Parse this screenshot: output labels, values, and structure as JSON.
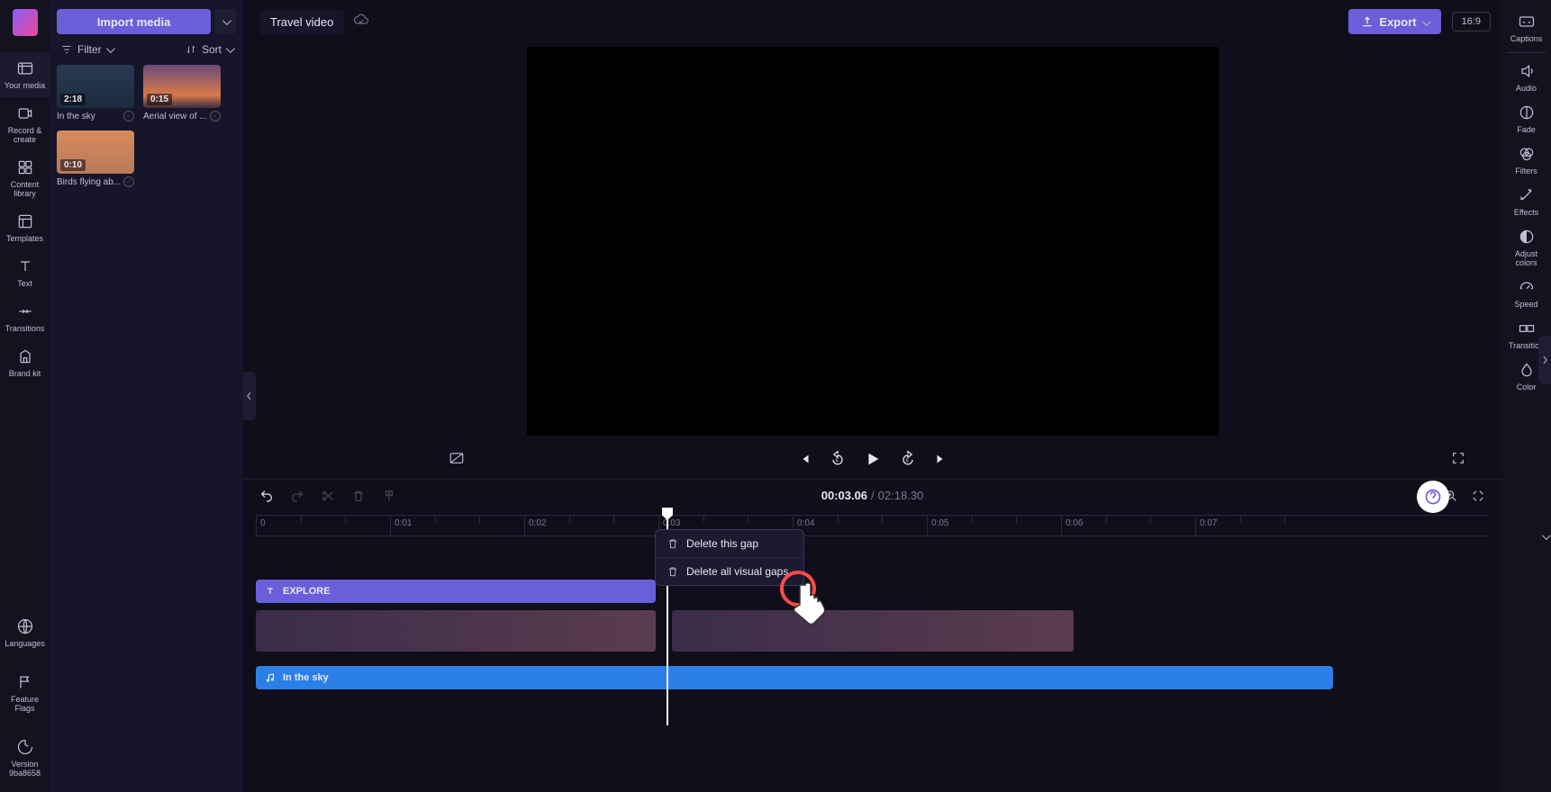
{
  "project": {
    "title": "Travel video"
  },
  "import": {
    "label": "Import media"
  },
  "filter": {
    "label": "Filter"
  },
  "sort": {
    "label": "Sort"
  },
  "export": {
    "label": "Export"
  },
  "aspect": {
    "label": "16:9"
  },
  "left_rail": [
    {
      "label": "Your media",
      "active": true
    },
    {
      "label": "Record &\ncreate",
      "active": false
    },
    {
      "label": "Content\nlibrary",
      "active": false
    },
    {
      "label": "Templates",
      "active": false
    },
    {
      "label": "Text",
      "active": false
    },
    {
      "label": "Transitions",
      "active": false
    },
    {
      "label": "Brand kit",
      "active": false
    }
  ],
  "left_bottom": [
    {
      "label": "Languages"
    },
    {
      "label": "Feature\nFlags"
    },
    {
      "label": "Version\n9ba8658"
    }
  ],
  "media": [
    {
      "duration": "2:18",
      "title": "In the sky",
      "bg": "linear-gradient(180deg,#2a3a52,#1c2b40)"
    },
    {
      "duration": "0:15",
      "title": "Aerial view of ...",
      "bg": "linear-gradient(180deg,#6a4a7a,#d97a4a 70%,#3a2c3e)"
    },
    {
      "duration": "0:10",
      "title": "Birds flying ab...",
      "bg": "linear-gradient(180deg,#d98a5a,#b87a5a)"
    }
  ],
  "right_rail": [
    {
      "label": "Captions"
    },
    {
      "label": "Audio"
    },
    {
      "label": "Fade"
    },
    {
      "label": "Filters"
    },
    {
      "label": "Effects"
    },
    {
      "label": "Adjust\ncolors"
    },
    {
      "label": "Speed"
    },
    {
      "label": "Transition"
    },
    {
      "label": "Color"
    }
  ],
  "time": {
    "current": "00:03.06",
    "separator": "/",
    "total": "02:18.30"
  },
  "ruler_ticks": [
    "0",
    "0:01",
    "0:02",
    "0:03",
    "0:04",
    "0:05",
    "0:06",
    "0:07"
  ],
  "tracks": {
    "text_label": "EXPLORE",
    "audio_label": "In the sky"
  },
  "context_menu": {
    "item1": "Delete this gap",
    "item2": "Delete all visual gaps"
  }
}
